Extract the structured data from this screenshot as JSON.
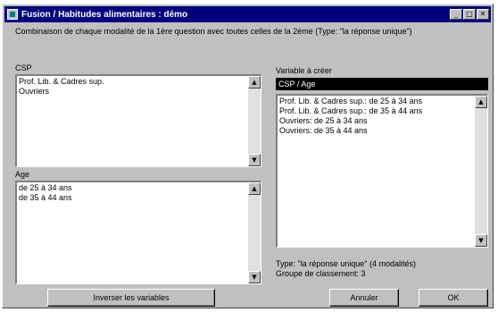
{
  "window": {
    "title": "Fusion / Habitudes alimentaires : démo",
    "minimize_glyph": "_",
    "maximize_glyph": "□",
    "close_glyph": "✕"
  },
  "instruction": "Combinaison de chaque modalité de la 1ère question avec toutes celles de la 2ème (Type: \"la réponse unique\")",
  "csp": {
    "label": "CSP",
    "items": [
      "Prof. Lib. & Cadres sup.",
      "Ouvriers"
    ]
  },
  "age": {
    "label": "Age",
    "items": [
      "de 25 à 34 ans",
      "de 35 à 44 ans"
    ]
  },
  "result": {
    "label": "Variable à créer",
    "name": "CSP / Age",
    "items": [
      "Prof. Lib. & Cadres sup.: de 25 à 34 ans",
      "Prof. Lib. & Cadres sup.: de 35 à 44 ans",
      "Ouvriers: de 25 à 34 ans",
      "Ouvriers: de 35 à 44 ans"
    ]
  },
  "info": {
    "type_line": "Type: \"la réponse unique\" (4 modalités)",
    "group_line": "Groupe de classement: 3"
  },
  "buttons": {
    "invert": "Inverser les variables",
    "cancel": "Annuler",
    "ok": "OK"
  },
  "icons": {
    "scroll_up": "▲",
    "scroll_down": "▼"
  }
}
